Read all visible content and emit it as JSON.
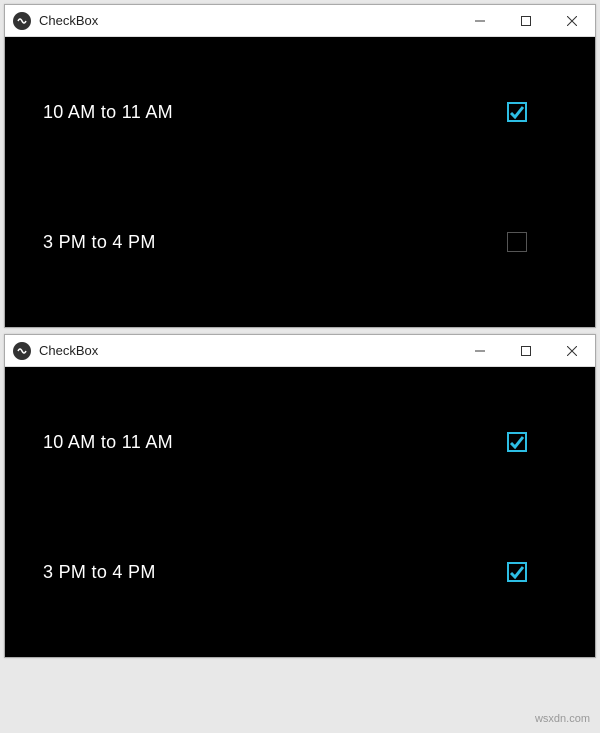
{
  "windows": [
    {
      "title": "CheckBox",
      "rows": [
        {
          "label": "10 AM to 11 AM",
          "checked": true
        },
        {
          "label": "3 PM to 4 PM",
          "checked": false
        }
      ]
    },
    {
      "title": "CheckBox",
      "rows": [
        {
          "label": "10 AM to 11 AM",
          "checked": true
        },
        {
          "label": "3 PM to 4 PM",
          "checked": true
        }
      ]
    }
  ],
  "watermark": "wsxdn.com"
}
